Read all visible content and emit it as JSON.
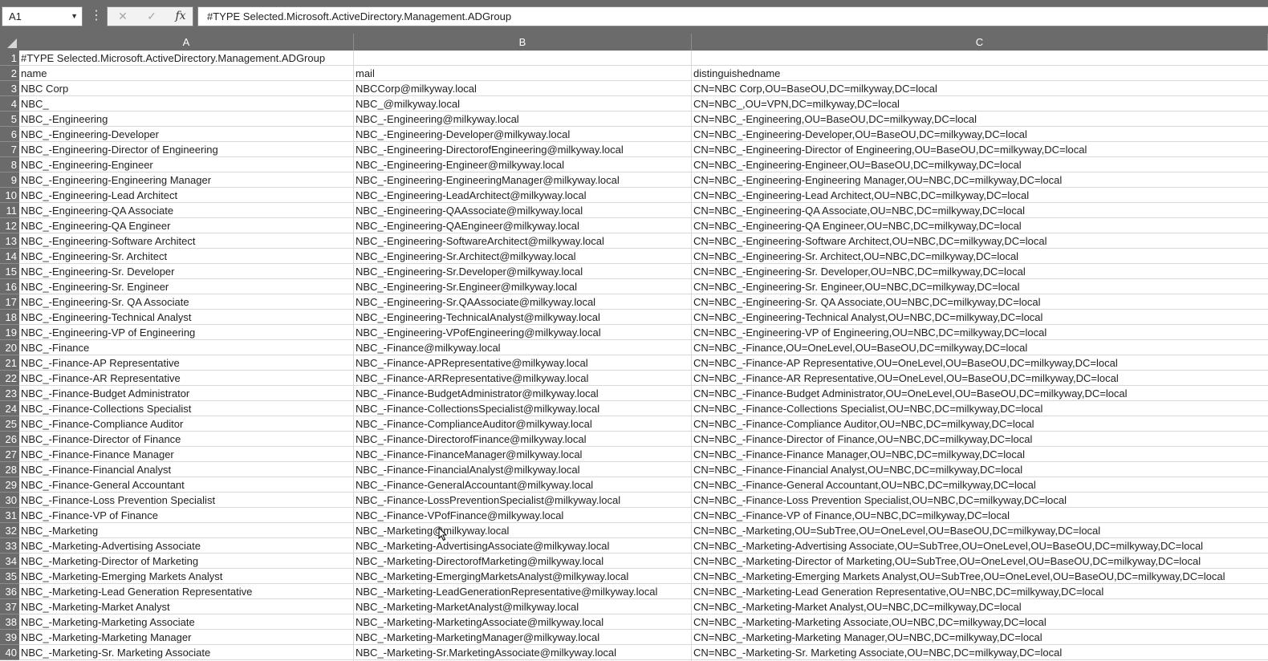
{
  "name_box": "A1",
  "name_box_dropdown": "▼",
  "more_icon": "⋮",
  "cancel_glyph": "✕",
  "enter_glyph": "✓",
  "fx_glyph": "fx",
  "formula_bar": "#TYPE Selected.Microsoft.ActiveDirectory.Management.ADGroup",
  "columns": [
    "A",
    "B",
    "C"
  ],
  "rows": [
    [
      "1",
      "#TYPE Selected.Microsoft.ActiveDirectory.Management.ADGroup",
      "",
      ""
    ],
    [
      "2",
      "name",
      "mail",
      "distinguishedname"
    ],
    [
      "3",
      "NBC Corp",
      "NBCCorp@milkyway.local",
      "CN=NBC Corp,OU=BaseOU,DC=milkyway,DC=local"
    ],
    [
      "4",
      "NBC_",
      "NBC_@milkyway.local",
      "CN=NBC_,OU=VPN,DC=milkyway,DC=local"
    ],
    [
      "5",
      "NBC_-Engineering",
      "NBC_-Engineering@milkyway.local",
      "CN=NBC_-Engineering,OU=BaseOU,DC=milkyway,DC=local"
    ],
    [
      "6",
      "NBC_-Engineering-Developer",
      "NBC_-Engineering-Developer@milkyway.local",
      "CN=NBC_-Engineering-Developer,OU=BaseOU,DC=milkyway,DC=local"
    ],
    [
      "7",
      "NBC_-Engineering-Director of Engineering",
      "NBC_-Engineering-DirectorofEngineering@milkyway.local",
      "CN=NBC_-Engineering-Director of Engineering,OU=BaseOU,DC=milkyway,DC=local"
    ],
    [
      "8",
      "NBC_-Engineering-Engineer",
      "NBC_-Engineering-Engineer@milkyway.local",
      "CN=NBC_-Engineering-Engineer,OU=BaseOU,DC=milkyway,DC=local"
    ],
    [
      "9",
      "NBC_-Engineering-Engineering Manager",
      "NBC_-Engineering-EngineeringManager@milkyway.local",
      "CN=NBC_-Engineering-Engineering Manager,OU=NBC,DC=milkyway,DC=local"
    ],
    [
      "10",
      "NBC_-Engineering-Lead Architect",
      "NBC_-Engineering-LeadArchitect@milkyway.local",
      "CN=NBC_-Engineering-Lead Architect,OU=NBC,DC=milkyway,DC=local"
    ],
    [
      "11",
      "NBC_-Engineering-QA Associate",
      "NBC_-Engineering-QAAssociate@milkyway.local",
      "CN=NBC_-Engineering-QA Associate,OU=NBC,DC=milkyway,DC=local"
    ],
    [
      "12",
      "NBC_-Engineering-QA Engineer",
      "NBC_-Engineering-QAEngineer@milkyway.local",
      "CN=NBC_-Engineering-QA Engineer,OU=NBC,DC=milkyway,DC=local"
    ],
    [
      "13",
      "NBC_-Engineering-Software Architect",
      "NBC_-Engineering-SoftwareArchitect@milkyway.local",
      "CN=NBC_-Engineering-Software Architect,OU=NBC,DC=milkyway,DC=local"
    ],
    [
      "14",
      "NBC_-Engineering-Sr. Architect",
      "NBC_-Engineering-Sr.Architect@milkyway.local",
      "CN=NBC_-Engineering-Sr. Architect,OU=NBC,DC=milkyway,DC=local"
    ],
    [
      "15",
      "NBC_-Engineering-Sr. Developer",
      "NBC_-Engineering-Sr.Developer@milkyway.local",
      "CN=NBC_-Engineering-Sr. Developer,OU=NBC,DC=milkyway,DC=local"
    ],
    [
      "16",
      "NBC_-Engineering-Sr. Engineer",
      "NBC_-Engineering-Sr.Engineer@milkyway.local",
      "CN=NBC_-Engineering-Sr. Engineer,OU=NBC,DC=milkyway,DC=local"
    ],
    [
      "17",
      "NBC_-Engineering-Sr. QA Associate",
      "NBC_-Engineering-Sr.QAAssociate@milkyway.local",
      "CN=NBC_-Engineering-Sr. QA Associate,OU=NBC,DC=milkyway,DC=local"
    ],
    [
      "18",
      "NBC_-Engineering-Technical Analyst",
      "NBC_-Engineering-TechnicalAnalyst@milkyway.local",
      "CN=NBC_-Engineering-Technical Analyst,OU=NBC,DC=milkyway,DC=local"
    ],
    [
      "19",
      "NBC_-Engineering-VP of Engineering",
      "NBC_-Engineering-VPofEngineering@milkyway.local",
      "CN=NBC_-Engineering-VP of Engineering,OU=NBC,DC=milkyway,DC=local"
    ],
    [
      "20",
      "NBC_-Finance",
      "NBC_-Finance@milkyway.local",
      "CN=NBC_-Finance,OU=OneLevel,OU=BaseOU,DC=milkyway,DC=local"
    ],
    [
      "21",
      "NBC_-Finance-AP Representative",
      "NBC_-Finance-APRepresentative@milkyway.local",
      "CN=NBC_-Finance-AP Representative,OU=OneLevel,OU=BaseOU,DC=milkyway,DC=local"
    ],
    [
      "22",
      "NBC_-Finance-AR Representative",
      "NBC_-Finance-ARRepresentative@milkyway.local",
      "CN=NBC_-Finance-AR Representative,OU=OneLevel,OU=BaseOU,DC=milkyway,DC=local"
    ],
    [
      "23",
      "NBC_-Finance-Budget Administrator",
      "NBC_-Finance-BudgetAdministrator@milkyway.local",
      "CN=NBC_-Finance-Budget Administrator,OU=OneLevel,OU=BaseOU,DC=milkyway,DC=local"
    ],
    [
      "24",
      "NBC_-Finance-Collections Specialist",
      "NBC_-Finance-CollectionsSpecialist@milkyway.local",
      "CN=NBC_-Finance-Collections Specialist,OU=NBC,DC=milkyway,DC=local"
    ],
    [
      "25",
      "NBC_-Finance-Compliance Auditor",
      "NBC_-Finance-ComplianceAuditor@milkyway.local",
      "CN=NBC_-Finance-Compliance Auditor,OU=NBC,DC=milkyway,DC=local"
    ],
    [
      "26",
      "NBC_-Finance-Director of Finance",
      "NBC_-Finance-DirectorofFinance@milkyway.local",
      "CN=NBC_-Finance-Director of Finance,OU=NBC,DC=milkyway,DC=local"
    ],
    [
      "27",
      "NBC_-Finance-Finance Manager",
      "NBC_-Finance-FinanceManager@milkyway.local",
      "CN=NBC_-Finance-Finance Manager,OU=NBC,DC=milkyway,DC=local"
    ],
    [
      "28",
      "NBC_-Finance-Financial Analyst",
      "NBC_-Finance-FinancialAnalyst@milkyway.local",
      "CN=NBC_-Finance-Financial Analyst,OU=NBC,DC=milkyway,DC=local"
    ],
    [
      "29",
      "NBC_-Finance-General Accountant",
      "NBC_-Finance-GeneralAccountant@milkyway.local",
      "CN=NBC_-Finance-General Accountant,OU=NBC,DC=milkyway,DC=local"
    ],
    [
      "30",
      "NBC_-Finance-Loss Prevention Specialist",
      "NBC_-Finance-LossPreventionSpecialist@milkyway.local",
      "CN=NBC_-Finance-Loss Prevention Specialist,OU=NBC,DC=milkyway,DC=local"
    ],
    [
      "31",
      "NBC_-Finance-VP of Finance",
      "NBC_-Finance-VPofFinance@milkyway.local",
      "CN=NBC_-Finance-VP of Finance,OU=NBC,DC=milkyway,DC=local"
    ],
    [
      "32",
      "NBC_-Marketing",
      "NBC_-Marketing@milkyway.local",
      "CN=NBC_-Marketing,OU=SubTree,OU=OneLevel,OU=BaseOU,DC=milkyway,DC=local"
    ],
    [
      "33",
      "NBC_-Marketing-Advertising Associate",
      "NBC_-Marketing-AdvertisingAssociate@milkyway.local",
      "CN=NBC_-Marketing-Advertising Associate,OU=SubTree,OU=OneLevel,OU=BaseOU,DC=milkyway,DC=local"
    ],
    [
      "34",
      "NBC_-Marketing-Director of Marketing",
      "NBC_-Marketing-DirectorofMarketing@milkyway.local",
      "CN=NBC_-Marketing-Director of Marketing,OU=SubTree,OU=OneLevel,OU=BaseOU,DC=milkyway,DC=local"
    ],
    [
      "35",
      "NBC_-Marketing-Emerging Markets Analyst",
      "NBC_-Marketing-EmergingMarketsAnalyst@milkyway.local",
      "CN=NBC_-Marketing-Emerging Markets Analyst,OU=SubTree,OU=OneLevel,OU=BaseOU,DC=milkyway,DC=local"
    ],
    [
      "36",
      "NBC_-Marketing-Lead Generation Representative",
      "NBC_-Marketing-LeadGenerationRepresentative@milkyway.local",
      "CN=NBC_-Marketing-Lead Generation Representative,OU=NBC,DC=milkyway,DC=local"
    ],
    [
      "37",
      "NBC_-Marketing-Market Analyst",
      "NBC_-Marketing-MarketAnalyst@milkyway.local",
      "CN=NBC_-Marketing-Market Analyst,OU=NBC,DC=milkyway,DC=local"
    ],
    [
      "38",
      "NBC_-Marketing-Marketing Associate",
      "NBC_-Marketing-MarketingAssociate@milkyway.local",
      "CN=NBC_-Marketing-Marketing Associate,OU=NBC,DC=milkyway,DC=local"
    ],
    [
      "39",
      "NBC_-Marketing-Marketing Manager",
      "NBC_-Marketing-MarketingManager@milkyway.local",
      "CN=NBC_-Marketing-Marketing Manager,OU=NBC,DC=milkyway,DC=local"
    ],
    [
      "40",
      "NBC_-Marketing-Sr. Marketing Associate",
      "NBC_-Marketing-Sr.MarketingAssociate@milkyway.local",
      "CN=NBC_-Marketing-Sr. Marketing Associate,OU=NBC,DC=milkyway,DC=local"
    ]
  ]
}
